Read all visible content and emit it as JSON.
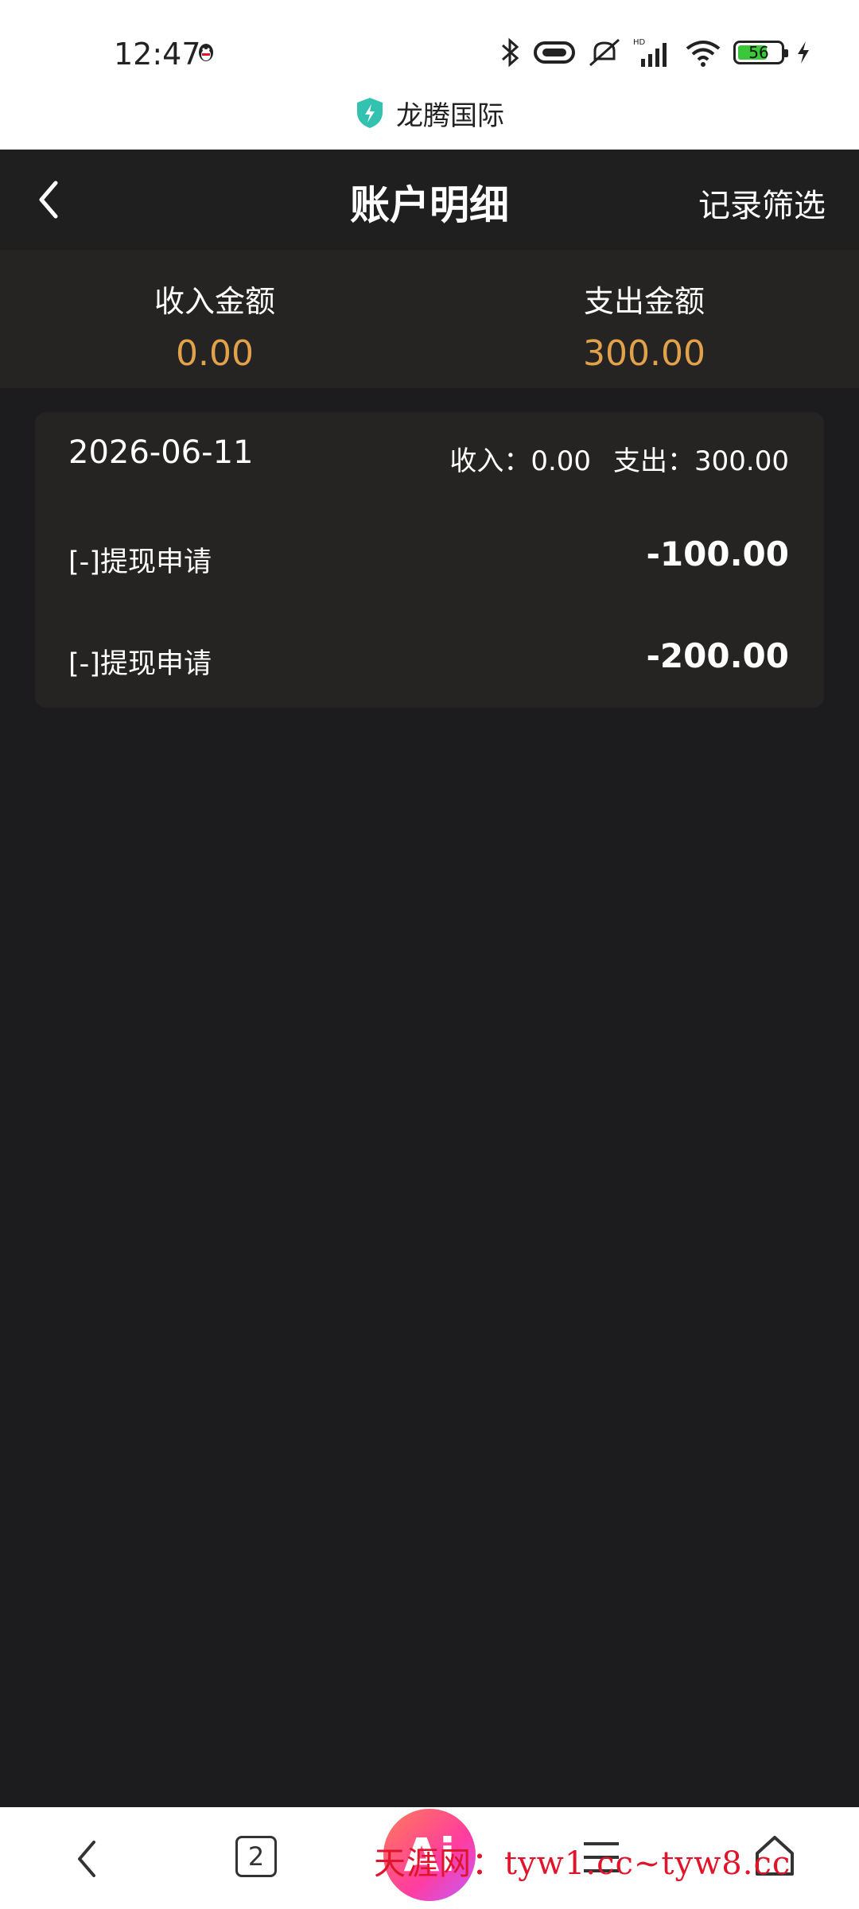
{
  "status_bar": {
    "time": "12:47",
    "battery": "56",
    "icons": [
      "qq-icon",
      "bluetooth-icon",
      "link-icon",
      "mute-icon",
      "hd-signal-icon",
      "wifi-icon",
      "battery-icon",
      "charging-icon"
    ]
  },
  "browser": {
    "site_name": "龙腾国际"
  },
  "header": {
    "title": "账户明细",
    "filter_label": "记录筛选"
  },
  "summary": {
    "income_label": "收入金额",
    "income_value": "0.00",
    "expense_label": "支出金额",
    "expense_value": "300.00"
  },
  "records": {
    "date": "2026-06-11",
    "income_text": "收入：0.00",
    "expense_text": "支出：300.00",
    "items": [
      {
        "label": "[-]提现申请",
        "amount": "-100.00"
      },
      {
        "label": "[-]提现申请",
        "amount": "-200.00"
      }
    ]
  },
  "bottom_nav": {
    "tab_count": "2",
    "ai_label": "Ai"
  },
  "watermark": "天涯网：tyw1.cc~tyw8.cc",
  "colors": {
    "background": "#1c1c1e",
    "accent": "#e2a24c",
    "card": "#262422"
  }
}
